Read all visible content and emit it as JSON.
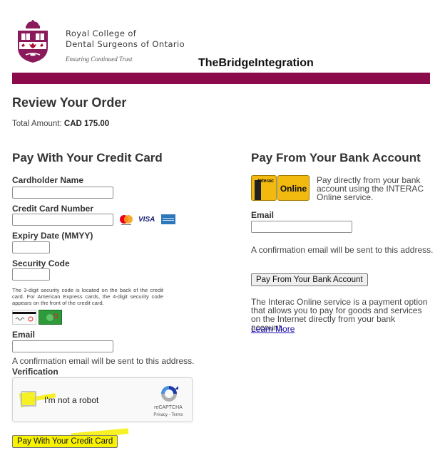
{
  "header": {
    "org_name_line1": "Royal College of",
    "org_name_line2": "Dental Surgeons of Ontario",
    "tagline": "Ensuring Continued Trust",
    "integration_title": "TheBridgeIntegration",
    "brand_color": "#8a0a4a"
  },
  "review": {
    "title": "Review Your Order",
    "total_label": "Total Amount:",
    "total_value": "CAD 175.00"
  },
  "credit_card": {
    "title": "Pay With Your Credit Card",
    "cardholder_label": "Cardholder Name",
    "cardholder_value": "",
    "card_number_label": "Credit Card Number",
    "card_number_value": "",
    "card_brands": [
      "mastercard-icon",
      "visa-icon",
      "amex-icon"
    ],
    "visa_text": "VISA",
    "expiry_label": "Expiry Date (MMYY)",
    "expiry_value": "",
    "security_label": "Security Code",
    "security_value": "",
    "security_help": "The 3-digit security code is located on the back of the credit card. For American Express cards, the 4-digit security code appears on the front of the credit card.",
    "email_label": "Email",
    "email_value": "",
    "email_note": "A confirmation email will be sent to this address.",
    "verification_label": "Verification",
    "captcha_text": "I'm not a robot",
    "captcha_brand": "reCAPTCHA",
    "captcha_links": "Privacy - Terms",
    "submit_label": "Pay With Your Credit Card",
    "highlight_color": "#f6f000"
  },
  "bank": {
    "title": "Pay From Your Bank Account",
    "interac_logo_text": "Interac",
    "online_logo_text": "Online",
    "description": "Pay directly from your bank account using the INTERAC Online service.",
    "email_label": "Email",
    "email_value": "",
    "email_note": "A confirmation email will be sent to this address.",
    "submit_label": "Pay From Your Bank Account",
    "info": "The Interac Online service is a payment option that allows you to pay for goods and services on the Internet directly from your bank account.",
    "learn_more": "Learn More",
    "interac_color": "#f2b90f"
  }
}
